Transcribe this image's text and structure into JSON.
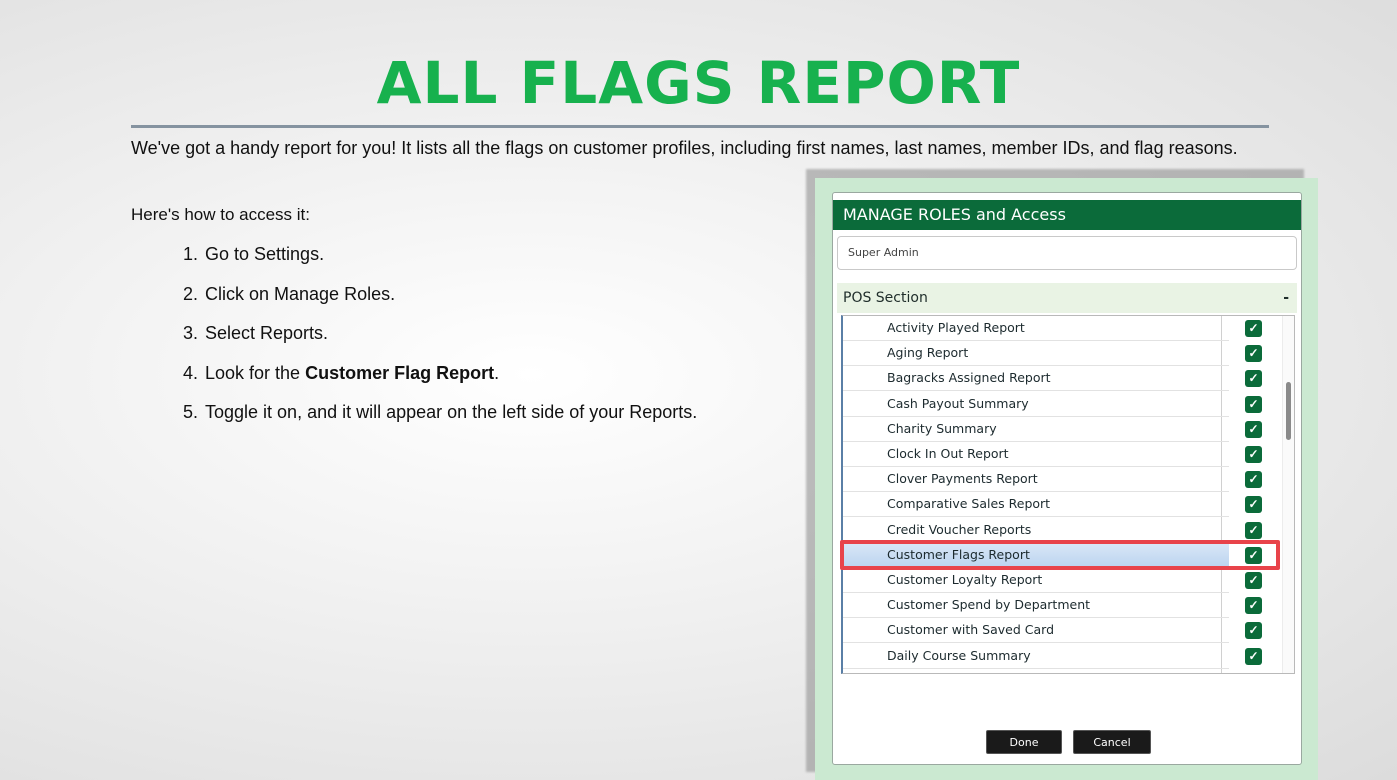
{
  "slide": {
    "title": "ALL FLAGS REPORT",
    "intro": "We've got a handy report for you! It lists all the flags on customer profiles, including first names, last names, member IDs, and flag reasons.",
    "howto": "Here's how to access it:",
    "steps": [
      {
        "num": "1.",
        "text": "Go to Settings."
      },
      {
        "num": "2.",
        "text": "Click on Manage Roles."
      },
      {
        "num": "3.",
        "text": "Select Reports."
      },
      {
        "num": "4.",
        "before": "Look for the ",
        "bold": "Customer Flag Report",
        "after": "."
      },
      {
        "num": "5.",
        "text": "Toggle it on, and it will appear on the left side of your Reports."
      }
    ]
  },
  "dialog": {
    "title": "MANAGE ROLES and Access",
    "role_value": "Super Admin",
    "section_label": "POS Section",
    "section_toggle": "-",
    "check_glyph": "✓",
    "reports": [
      "Activity Played Report",
      "Aging Report",
      "Bagracks Assigned Report",
      "Cash Payout Summary",
      "Charity Summary",
      "Clock In Out Report",
      "Clover Payments Report",
      "Comparative Sales Report",
      "Credit Voucher Reports",
      "Customer Flags Report",
      "Customer Loyalty Report",
      "Customer Spend by Department",
      "Customer with Saved Card",
      "Daily Course Summary"
    ],
    "highlighted_report": "Customer Flags Report",
    "done_label": "Done",
    "cancel_label": "Cancel"
  },
  "colors": {
    "title_green": "#17b14e",
    "header_green": "#0b6b3a",
    "highlight_red": "#e8434a"
  }
}
